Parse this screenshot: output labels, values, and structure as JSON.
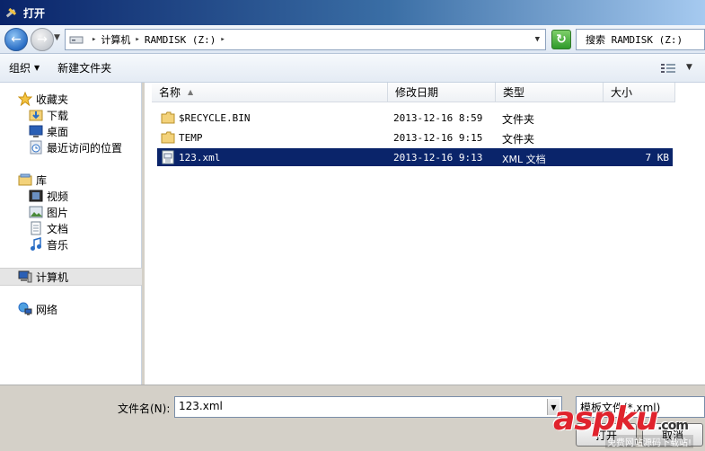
{
  "window": {
    "title": "打开"
  },
  "address_bar": {
    "crumbs": [
      "计算机",
      "RAMDISK (Z:)"
    ],
    "search_placeholder": "搜索 RAMDISK (Z:)"
  },
  "toolbar": {
    "organize_label": "组织",
    "new_folder_label": "新建文件夹"
  },
  "sidebar": {
    "favorites_header": "收藏夹",
    "favorites": [
      "下载",
      "桌面",
      "最近访问的位置"
    ],
    "libraries_header": "库",
    "libraries": [
      "视频",
      "图片",
      "文档",
      "音乐"
    ],
    "computer": "计算机",
    "network": "网络"
  },
  "file_list": {
    "columns": [
      "名称",
      "修改日期",
      "类型",
      "大小"
    ],
    "rows": [
      {
        "name": "$RECYCLE.BIN",
        "date": "2013-12-16 8:59",
        "type": "文件夹",
        "size": "",
        "icon": "folder-icon"
      },
      {
        "name": "TEMP",
        "date": "2013-12-16 9:15",
        "type": "文件夹",
        "size": "",
        "icon": "folder-icon"
      },
      {
        "name": "123.xml",
        "date": "2013-12-16 9:13",
        "type": "XML 文档",
        "size": "7 KB",
        "icon": "xml-file-icon",
        "selected": true
      }
    ]
  },
  "bottom": {
    "filename_label": "文件名(N):",
    "filename_value": "123.xml",
    "filter_value": "模板文件(*.xml)",
    "open_label": "打开",
    "cancel_label": "取消"
  },
  "watermark": {
    "logo_asp": "asp",
    "logo_ku": "ku",
    "logo_com": ".com",
    "sub": "免费网站源码下载站!"
  },
  "colors": {
    "selection": "#0a246a",
    "title_gradient_start": "#0a246a",
    "watermark_red": "#e0232d"
  }
}
